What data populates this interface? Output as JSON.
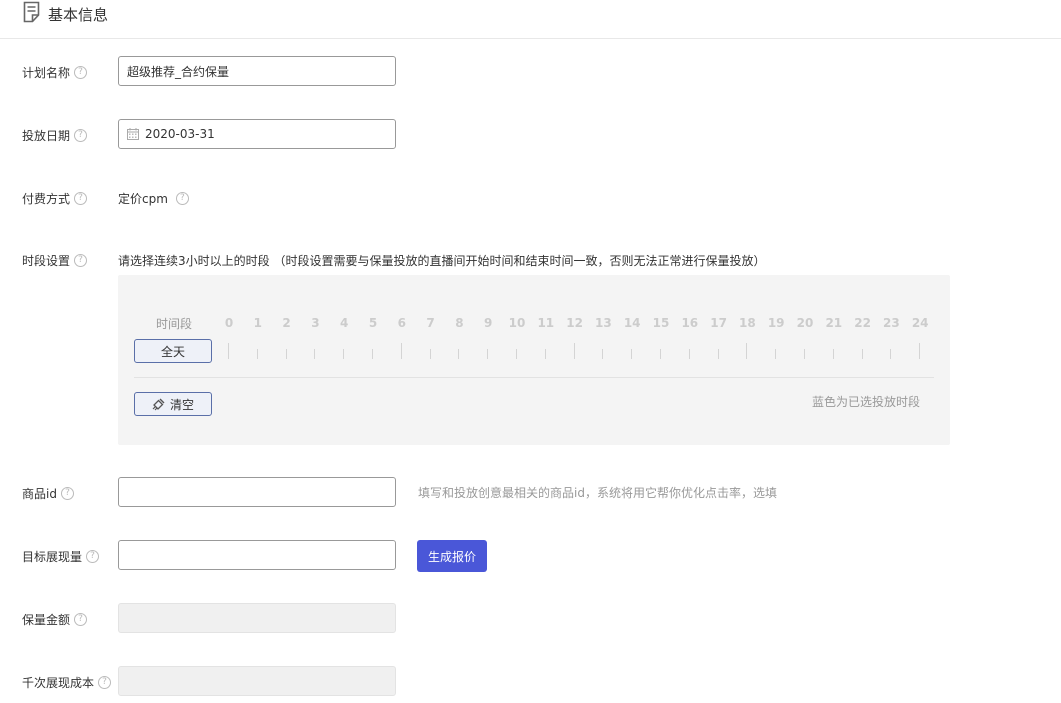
{
  "section": {
    "title": "基本信息",
    "icon": "document-icon"
  },
  "fields": {
    "plan_name": {
      "label": "计划名称",
      "value": "超级推荐_合约保量"
    },
    "date": {
      "label": "投放日期",
      "value": "2020-03-31",
      "icon": "calendar-icon"
    },
    "pay": {
      "label": "付费方式",
      "value": "定价cpm"
    },
    "time": {
      "label": "时段设置",
      "desc": "请选择连续3小时以上的时段 （时段设置需要与保量投放的直播间开始时间和结束时间一致，否则无法正常进行保量投放）"
    },
    "product": {
      "label": "商品id",
      "value": "",
      "helper": "填写和投放创意最相关的商品id，系统将用它帮你优化点击率，选填"
    },
    "target": {
      "label": "目标展现量",
      "value": "",
      "button": "生成报价"
    },
    "amount": {
      "label": "保量金额",
      "value": ""
    },
    "cpm": {
      "label": "千次展现成本",
      "value": ""
    }
  },
  "schedule": {
    "row_label": "时间段",
    "hours": [
      "0",
      "1",
      "2",
      "3",
      "4",
      "5",
      "6",
      "7",
      "8",
      "9",
      "10",
      "11",
      "12",
      "13",
      "14",
      "15",
      "16",
      "17",
      "18",
      "19",
      "20",
      "21",
      "22",
      "23",
      "24"
    ],
    "all_day": "全天",
    "clear": "清空",
    "hint": "蓝色为已选投放时段"
  },
  "colors": {
    "primary": "#4a57d8",
    "outline": "#5a6fa8"
  }
}
